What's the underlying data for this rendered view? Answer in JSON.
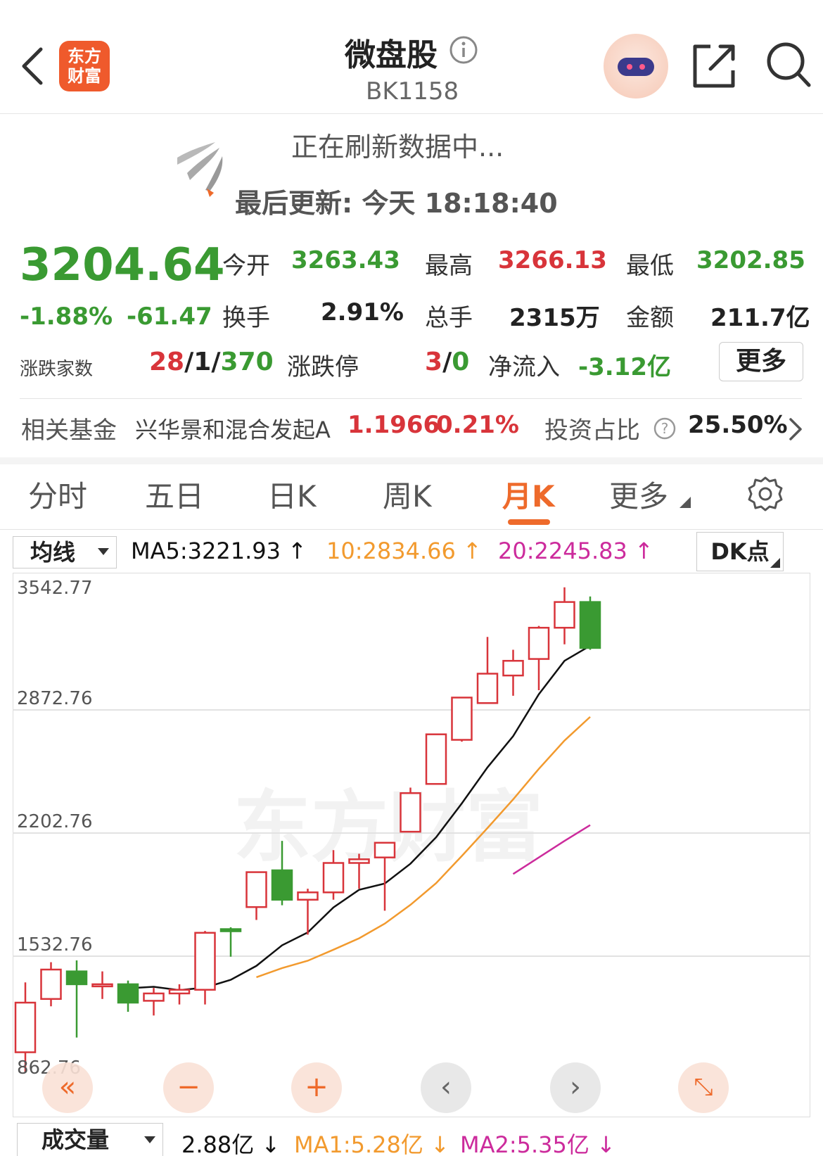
{
  "header": {
    "title": "微盘股",
    "code": "BK1158",
    "logo_text_line1": "东方",
    "logo_text_line2": "财富"
  },
  "refresh": {
    "status": "正在刷新数据中...",
    "last_update": "最后更新:  今天 18:18:40"
  },
  "quote": {
    "price": "3204.64",
    "change_pct": "-1.88%",
    "change_abs": "-61.47",
    "open_label": "今开",
    "open_value": "3263.43",
    "high_label": "最高",
    "high_value": "3266.13",
    "low_label": "最低",
    "low_value": "3202.85",
    "turnover_label": "换手",
    "turnover_value": "2.91%",
    "volume_label": "总手",
    "volume_value": "2315万",
    "amount_label": "金额",
    "amount_value": "211.7亿",
    "breadth_label": "涨跌家数",
    "breadth_up": "28",
    "breadth_sep1": "/",
    "breadth_flat": "1",
    "breadth_sep2": "/",
    "breadth_down": "370",
    "limit_label": "涨跌停",
    "limit_up": "3",
    "limit_sep": "/",
    "limit_down": "0",
    "netflow_label": "净流入",
    "netflow_value": "-3.12亿",
    "more_label": "更多"
  },
  "fund": {
    "label": "相关基金",
    "name": "兴华景和混合发起A",
    "price": "1.1966",
    "change": "0.21%",
    "ratio_label": "投资占比",
    "ratio_value": "25.50%"
  },
  "tabs": [
    "分时",
    "五日",
    "日K",
    "周K",
    "月K",
    "更多"
  ],
  "active_tab": "月K",
  "chart_header": {
    "select_label": "均线",
    "ma5": "MA5:3221.93",
    "ma10": "10:2834.66",
    "ma20": "20:2245.83",
    "dk_label": "DK点"
  },
  "volume_header": {
    "select_label": "成交量",
    "vol": "2.88亿",
    "ma1": "MA1:5.28亿",
    "ma2": "MA2:5.35亿"
  },
  "colors": {
    "up": "#d8343a",
    "down": "#3a9a32",
    "ma5": "#111111",
    "ma10": "#f29a2e",
    "ma20": "#cc2b9c",
    "accent": "#ee6a2b"
  },
  "chart_data": {
    "type": "candlestick",
    "title": "",
    "y_ticks": [
      "3542.77",
      "2872.76",
      "2202.76",
      "1532.76",
      "862.76"
    ],
    "ylim": [
      862.76,
      3542.77
    ],
    "candles": [
      {
        "o": 1010,
        "c": 1280,
        "h": 1390,
        "l": 900
      },
      {
        "o": 1300,
        "c": 1460,
        "h": 1500,
        "l": 1260
      },
      {
        "o": 1450,
        "c": 1380,
        "h": 1510,
        "l": 1090
      },
      {
        "o": 1380,
        "c": 1380,
        "h": 1450,
        "l": 1300
      },
      {
        "o": 1380,
        "c": 1280,
        "h": 1400,
        "l": 1230
      },
      {
        "o": 1290,
        "c": 1330,
        "h": 1360,
        "l": 1210
      },
      {
        "o": 1330,
        "c": 1350,
        "h": 1380,
        "l": 1270
      },
      {
        "o": 1350,
        "c": 1660,
        "h": 1670,
        "l": 1270
      },
      {
        "o": 1680,
        "c": 1670,
        "h": 1690,
        "l": 1530
      },
      {
        "o": 1800,
        "c": 1990,
        "h": 1990,
        "l": 1730
      },
      {
        "o": 2000,
        "c": 1840,
        "h": 2160,
        "l": 1810
      },
      {
        "o": 1840,
        "c": 1880,
        "h": 1900,
        "l": 1650
      },
      {
        "o": 1880,
        "c": 2040,
        "h": 2110,
        "l": 1840
      },
      {
        "o": 2040,
        "c": 2060,
        "h": 2090,
        "l": 1900
      },
      {
        "o": 2070,
        "c": 2150,
        "h": 2150,
        "l": 1780
      },
      {
        "o": 2210,
        "c": 2420,
        "h": 2450,
        "l": 2210
      },
      {
        "o": 2470,
        "c": 2740,
        "h": 2740,
        "l": 2470
      },
      {
        "o": 2710,
        "c": 2940,
        "h": 2940,
        "l": 2700
      },
      {
        "o": 2910,
        "c": 3070,
        "h": 3270,
        "l": 2910
      },
      {
        "o": 3060,
        "c": 3140,
        "h": 3200,
        "l": 2950
      },
      {
        "o": 3150,
        "c": 3320,
        "h": 3330,
        "l": 2980
      },
      {
        "o": 3320,
        "c": 3460,
        "h": 3540,
        "l": 3230
      },
      {
        "o": 3460,
        "c": 3210,
        "h": 3490,
        "l": 3200
      }
    ],
    "ma5": [
      null,
      null,
      null,
      null,
      1358,
      1366,
      1348,
      1362,
      1404,
      1480,
      1592,
      1662,
      1798,
      1894,
      1928,
      2036,
      2180,
      2364,
      2560,
      2730,
      2958,
      3140,
      3222
    ],
    "ma10": [
      null,
      null,
      null,
      null,
      null,
      null,
      null,
      null,
      null,
      1418,
      1468,
      1508,
      1568,
      1630,
      1710,
      1812,
      1930,
      2078,
      2230,
      2386,
      2552,
      2706,
      2835
    ],
    "ma20": [
      null,
      null,
      null,
      null,
      null,
      null,
      null,
      null,
      null,
      null,
      null,
      null,
      null,
      null,
      null,
      null,
      null,
      null,
      null,
      1980,
      2070,
      2160,
      2246
    ]
  }
}
